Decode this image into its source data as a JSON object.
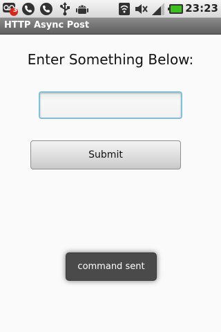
{
  "status_bar": {
    "notification_count": "3",
    "time": "23:23",
    "icons": [
      "voicemail-icon",
      "phone-icon",
      "phone-icon",
      "usb-icon",
      "android-debug-icon",
      "wifi-icon",
      "mute-icon",
      "signal-icon",
      "battery-icon"
    ]
  },
  "app": {
    "title": "HTTP Async Post"
  },
  "form": {
    "heading": "Enter Something Below:",
    "input_value": "",
    "submit_label": "Submit"
  },
  "toast": {
    "message": "command sent"
  },
  "colors": {
    "input_focus": "#7ec0d8",
    "battery": "#3cbf1f",
    "toast_bg": "#4a4a4a"
  }
}
